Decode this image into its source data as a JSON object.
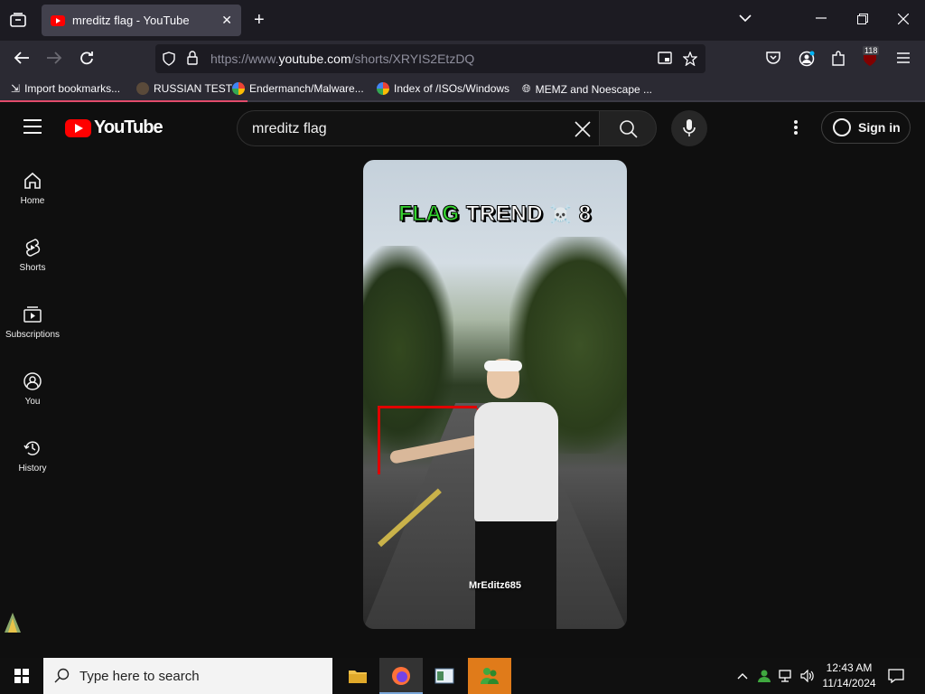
{
  "browser": {
    "tab_title": "mreditz flag - YouTube",
    "url_prefix": "https://www.",
    "url_domain": "youtube.com",
    "url_path": "/shorts/XRYIS2EtzDQ",
    "extension_badge": "118"
  },
  "bookmarks": [
    {
      "label": "Import bookmarks..."
    },
    {
      "label": "RUSSIAN TEST"
    },
    {
      "label": "Endermanch/Malware..."
    },
    {
      "label": "Index of /ISOs/Windows"
    },
    {
      "label": "MEMZ and Noescape ..."
    }
  ],
  "youtube": {
    "logo_text": "YouTube",
    "search_value": "mreditz flag",
    "sign_in_label": "Sign in",
    "sidebar": [
      {
        "label": "Home",
        "icon": "home-icon"
      },
      {
        "label": "Shorts",
        "icon": "shorts-icon"
      },
      {
        "label": "Subscriptions",
        "icon": "subscriptions-icon"
      },
      {
        "label": "You",
        "icon": "you-icon"
      },
      {
        "label": "History",
        "icon": "history-icon"
      }
    ],
    "video": {
      "title_green": "FLAG",
      "title_white": "TREND",
      "title_emoji": "☠️",
      "title_suffix": "8",
      "watermark": "MrEditz685"
    }
  },
  "taskbar": {
    "search_placeholder": "Type here to search",
    "time": "12:43 AM",
    "date": "11/14/2024"
  },
  "colors": {
    "youtube_red": "#ff0000",
    "title_green": "#35d430"
  }
}
